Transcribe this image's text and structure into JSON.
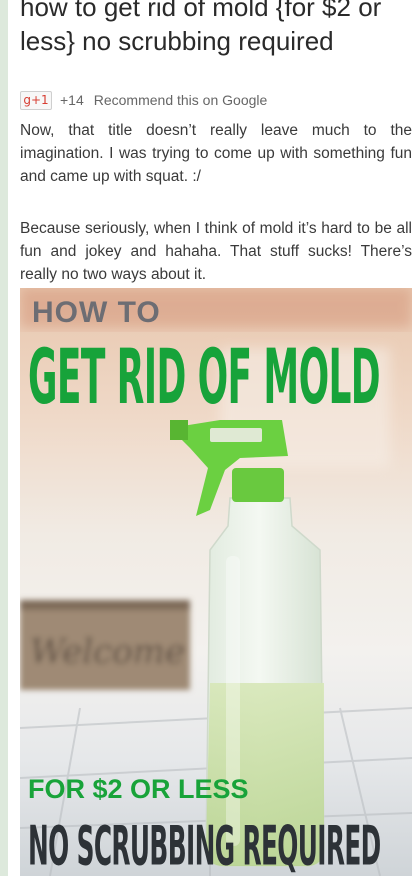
{
  "article": {
    "title": "how to get rid of mold {for $2 or less} no scrubbing required",
    "gplus": {
      "button_label": "g+1",
      "count": "+14",
      "recommend_text": "Recommend this on Google"
    },
    "paragraphs": [
      "Now, that title doesn’t really leave much to the imagination.  I was trying to come up with something fun and came up with squat.  :/",
      "Because seriously, when I think of mold it’s hard to be all fun and jokey and hahaha.  That stuff sucks!  There’s really no two ways about it."
    ],
    "image": {
      "line1": "HOW TO",
      "line2": "GET RID OF MOLD",
      "line3": "FOR $2 OR LESS",
      "line4": "NO SCRUBBING REQUIRED",
      "crate_text": "Welcome",
      "colors": {
        "accent_green": "#17a33a",
        "dark_text": "#2d3237",
        "grey_text": "#6d6d73"
      }
    }
  }
}
